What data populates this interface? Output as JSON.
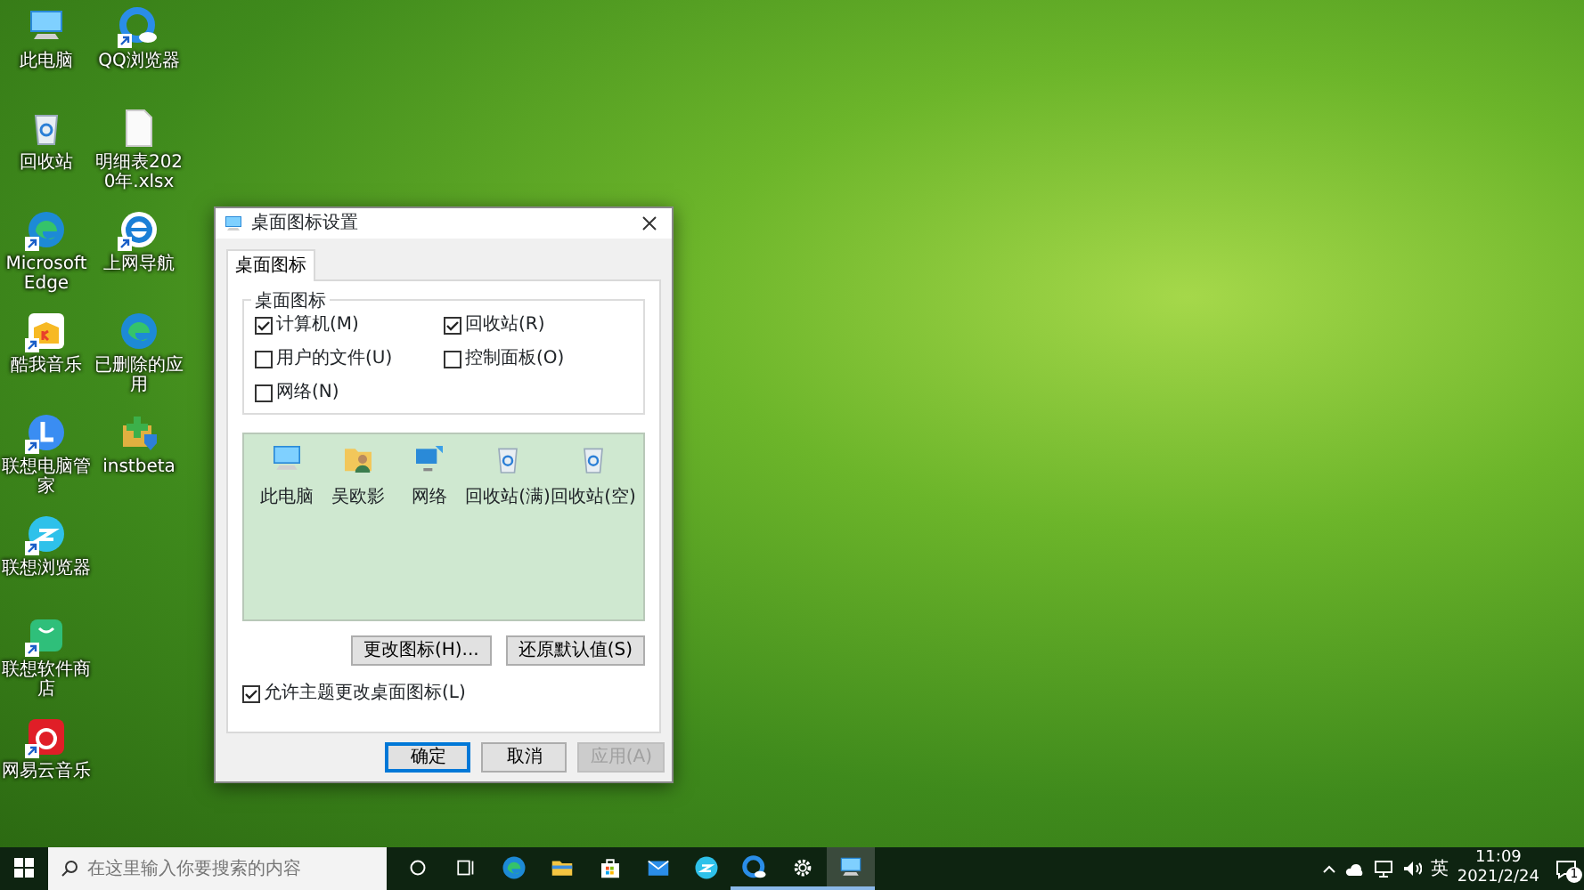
{
  "desktop": {
    "icons": [
      {
        "label": "此电脑",
        "kind": "computer",
        "shortcut": false
      },
      {
        "label": "回收站",
        "kind": "recycle",
        "shortcut": false
      },
      {
        "label": "Microsoft Edge",
        "kind": "edge",
        "shortcut": true
      },
      {
        "label": "酷我音乐",
        "kind": "music-box",
        "shortcut": true
      },
      {
        "label": "联想电脑管家",
        "kind": "blue-circle",
        "shortcut": true
      },
      {
        "label": "联想浏览器",
        "kind": "cyan-circle",
        "shortcut": true
      },
      {
        "label": "联想软件商店",
        "kind": "bag",
        "shortcut": true
      },
      {
        "label": "网易云音乐",
        "kind": "red-app",
        "shortcut": true
      },
      {
        "label": "QQ浏览器",
        "kind": "qq-browser",
        "shortcut": true
      },
      {
        "label": "明细表2020年.xlsx",
        "kind": "document",
        "shortcut": false
      },
      {
        "label": "上网导航",
        "kind": "ie",
        "shortcut": true
      },
      {
        "label": "已删除的应用",
        "kind": "edge",
        "shortcut": false
      },
      {
        "label": "instbeta",
        "kind": "package",
        "shortcut": false
      }
    ]
  },
  "dialog": {
    "title": "桌面图标设置",
    "tabs": [
      {
        "label": "桌面图标",
        "selected": true
      }
    ],
    "group_title": "桌面图标",
    "checkboxes": [
      {
        "label": "计算机(M)",
        "checked": true
      },
      {
        "label": "回收站(R)",
        "checked": true
      },
      {
        "label": "用户的文件(U)",
        "checked": false
      },
      {
        "label": "控制面板(O)",
        "checked": false
      },
      {
        "label": "网络(N)",
        "checked": false
      }
    ],
    "icons": [
      {
        "label": "此电脑",
        "kind": "computer"
      },
      {
        "label": "吴欧影",
        "kind": "user-folder"
      },
      {
        "label": "网络",
        "kind": "network"
      },
      {
        "label": "回收站(满)",
        "kind": "recycle"
      },
      {
        "label": "回收站(空)",
        "kind": "recycle"
      }
    ],
    "icon_buttons": [
      {
        "label": "更改图标(H)..."
      },
      {
        "label": "还原默认值(S)"
      }
    ],
    "theme_checkbox": {
      "label": "允许主题更改桌面图标(L)",
      "checked": true
    },
    "footer_buttons": [
      {
        "label": "确定",
        "default": true,
        "disabled": false
      },
      {
        "label": "取消",
        "default": false,
        "disabled": false
      },
      {
        "label": "应用(A)",
        "default": false,
        "disabled": true
      }
    ]
  },
  "taskbar": {
    "search_placeholder": "在这里输入你要搜索的内容",
    "apps": [
      {
        "kind": "cortana",
        "running": false,
        "active": false
      },
      {
        "kind": "taskview",
        "running": false,
        "active": false
      },
      {
        "kind": "edge",
        "running": false,
        "active": false
      },
      {
        "kind": "folder",
        "running": false,
        "active": false
      },
      {
        "kind": "store",
        "running": false,
        "active": false
      },
      {
        "kind": "mail",
        "running": false,
        "active": false
      },
      {
        "kind": "cyan-circle",
        "running": false,
        "active": false
      },
      {
        "kind": "qq-browser",
        "running": true,
        "active": false
      },
      {
        "kind": "gear",
        "running": true,
        "active": false
      },
      {
        "kind": "computer",
        "running": true,
        "active": true
      }
    ],
    "ime": "英",
    "time": "11:09",
    "date": "2021/2/24",
    "notification_count": "1"
  }
}
